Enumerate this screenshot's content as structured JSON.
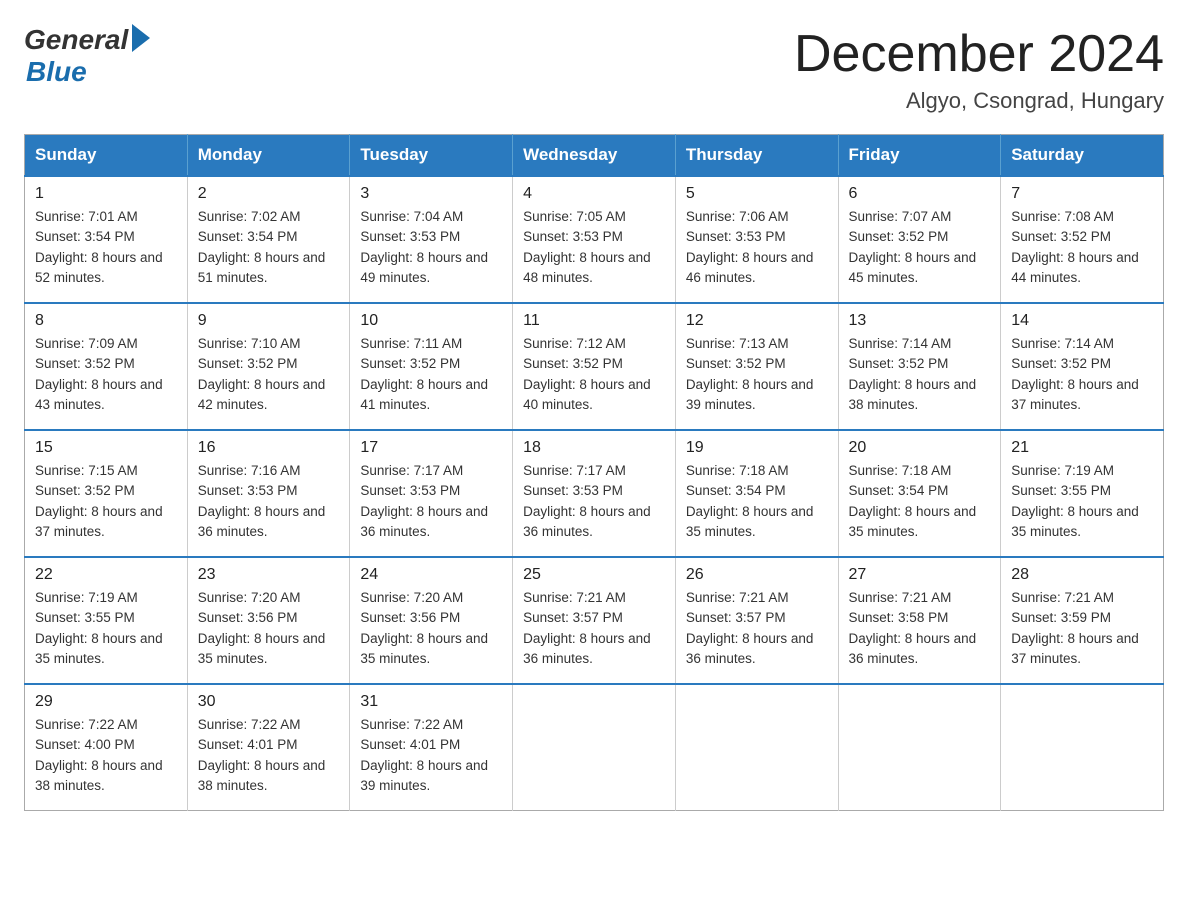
{
  "logo": {
    "general": "General",
    "blue": "Blue"
  },
  "title": "December 2024",
  "location": "Algyo, Csongrad, Hungary",
  "headers": [
    "Sunday",
    "Monday",
    "Tuesday",
    "Wednesday",
    "Thursday",
    "Friday",
    "Saturday"
  ],
  "weeks": [
    [
      {
        "day": "1",
        "sunrise": "7:01 AM",
        "sunset": "3:54 PM",
        "daylight": "8 hours and 52 minutes."
      },
      {
        "day": "2",
        "sunrise": "7:02 AM",
        "sunset": "3:54 PM",
        "daylight": "8 hours and 51 minutes."
      },
      {
        "day": "3",
        "sunrise": "7:04 AM",
        "sunset": "3:53 PM",
        "daylight": "8 hours and 49 minutes."
      },
      {
        "day": "4",
        "sunrise": "7:05 AM",
        "sunset": "3:53 PM",
        "daylight": "8 hours and 48 minutes."
      },
      {
        "day": "5",
        "sunrise": "7:06 AM",
        "sunset": "3:53 PM",
        "daylight": "8 hours and 46 minutes."
      },
      {
        "day": "6",
        "sunrise": "7:07 AM",
        "sunset": "3:52 PM",
        "daylight": "8 hours and 45 minutes."
      },
      {
        "day": "7",
        "sunrise": "7:08 AM",
        "sunset": "3:52 PM",
        "daylight": "8 hours and 44 minutes."
      }
    ],
    [
      {
        "day": "8",
        "sunrise": "7:09 AM",
        "sunset": "3:52 PM",
        "daylight": "8 hours and 43 minutes."
      },
      {
        "day": "9",
        "sunrise": "7:10 AM",
        "sunset": "3:52 PM",
        "daylight": "8 hours and 42 minutes."
      },
      {
        "day": "10",
        "sunrise": "7:11 AM",
        "sunset": "3:52 PM",
        "daylight": "8 hours and 41 minutes."
      },
      {
        "day": "11",
        "sunrise": "7:12 AM",
        "sunset": "3:52 PM",
        "daylight": "8 hours and 40 minutes."
      },
      {
        "day": "12",
        "sunrise": "7:13 AM",
        "sunset": "3:52 PM",
        "daylight": "8 hours and 39 minutes."
      },
      {
        "day": "13",
        "sunrise": "7:14 AM",
        "sunset": "3:52 PM",
        "daylight": "8 hours and 38 minutes."
      },
      {
        "day": "14",
        "sunrise": "7:14 AM",
        "sunset": "3:52 PM",
        "daylight": "8 hours and 37 minutes."
      }
    ],
    [
      {
        "day": "15",
        "sunrise": "7:15 AM",
        "sunset": "3:52 PM",
        "daylight": "8 hours and 37 minutes."
      },
      {
        "day": "16",
        "sunrise": "7:16 AM",
        "sunset": "3:53 PM",
        "daylight": "8 hours and 36 minutes."
      },
      {
        "day": "17",
        "sunrise": "7:17 AM",
        "sunset": "3:53 PM",
        "daylight": "8 hours and 36 minutes."
      },
      {
        "day": "18",
        "sunrise": "7:17 AM",
        "sunset": "3:53 PM",
        "daylight": "8 hours and 36 minutes."
      },
      {
        "day": "19",
        "sunrise": "7:18 AM",
        "sunset": "3:54 PM",
        "daylight": "8 hours and 35 minutes."
      },
      {
        "day": "20",
        "sunrise": "7:18 AM",
        "sunset": "3:54 PM",
        "daylight": "8 hours and 35 minutes."
      },
      {
        "day": "21",
        "sunrise": "7:19 AM",
        "sunset": "3:55 PM",
        "daylight": "8 hours and 35 minutes."
      }
    ],
    [
      {
        "day": "22",
        "sunrise": "7:19 AM",
        "sunset": "3:55 PM",
        "daylight": "8 hours and 35 minutes."
      },
      {
        "day": "23",
        "sunrise": "7:20 AM",
        "sunset": "3:56 PM",
        "daylight": "8 hours and 35 minutes."
      },
      {
        "day": "24",
        "sunrise": "7:20 AM",
        "sunset": "3:56 PM",
        "daylight": "8 hours and 35 minutes."
      },
      {
        "day": "25",
        "sunrise": "7:21 AM",
        "sunset": "3:57 PM",
        "daylight": "8 hours and 36 minutes."
      },
      {
        "day": "26",
        "sunrise": "7:21 AM",
        "sunset": "3:57 PM",
        "daylight": "8 hours and 36 minutes."
      },
      {
        "day": "27",
        "sunrise": "7:21 AM",
        "sunset": "3:58 PM",
        "daylight": "8 hours and 36 minutes."
      },
      {
        "day": "28",
        "sunrise": "7:21 AM",
        "sunset": "3:59 PM",
        "daylight": "8 hours and 37 minutes."
      }
    ],
    [
      {
        "day": "29",
        "sunrise": "7:22 AM",
        "sunset": "4:00 PM",
        "daylight": "8 hours and 38 minutes."
      },
      {
        "day": "30",
        "sunrise": "7:22 AM",
        "sunset": "4:01 PM",
        "daylight": "8 hours and 38 minutes."
      },
      {
        "day": "31",
        "sunrise": "7:22 AM",
        "sunset": "4:01 PM",
        "daylight": "8 hours and 39 minutes."
      },
      null,
      null,
      null,
      null
    ]
  ]
}
